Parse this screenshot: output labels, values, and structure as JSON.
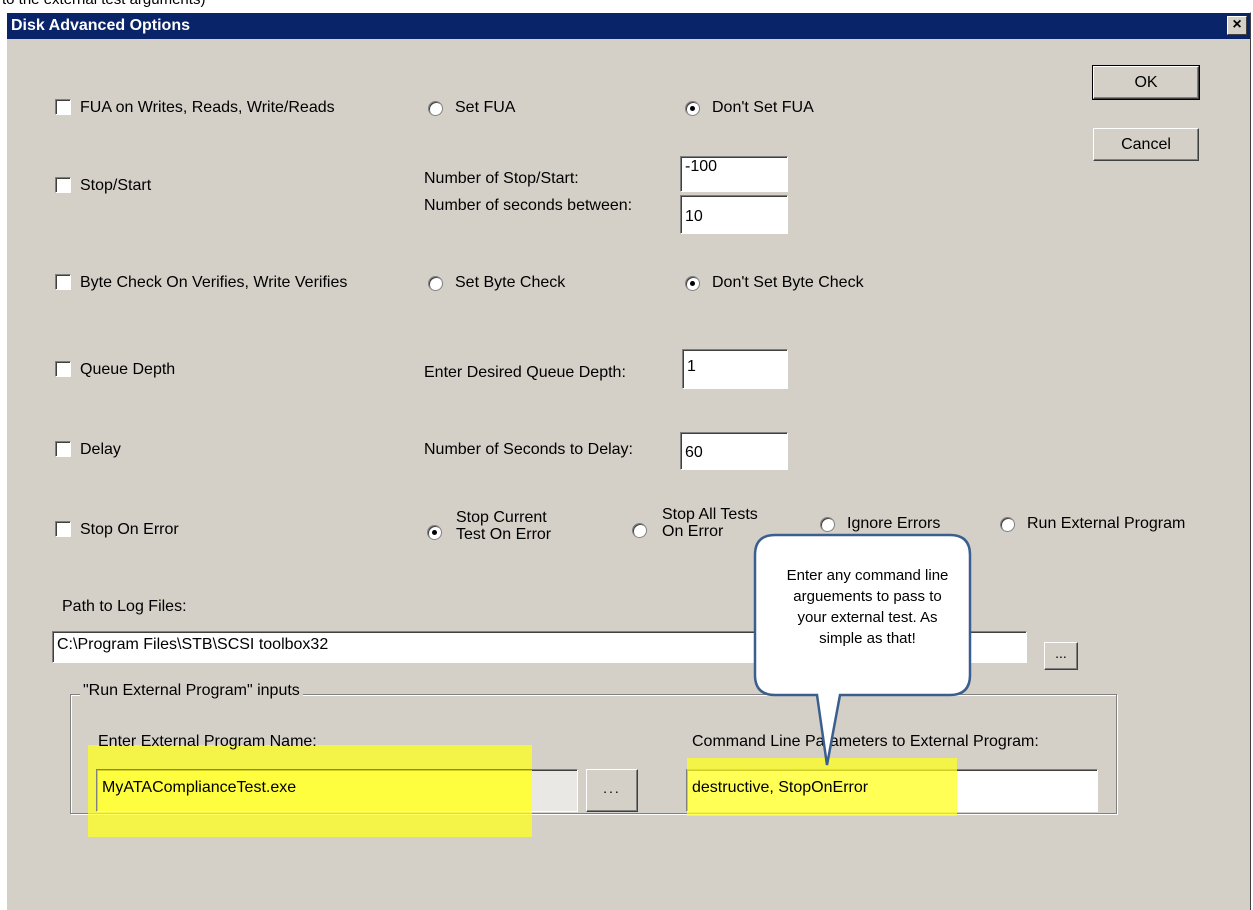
{
  "top_caption": "to the external test arguments)",
  "dialog": {
    "title": "Disk Advanced Options",
    "close_glyph": "×"
  },
  "buttons": {
    "ok": "OK",
    "cancel": "Cancel",
    "browse": "...",
    "browse_exe": "..."
  },
  "rows": {
    "fua": {
      "checkbox": "FUA on Writes, Reads, Write/Reads",
      "opt1": "Set FUA",
      "opt2": "Don't Set FUA",
      "selected": "opt2"
    },
    "stopstart": {
      "checkbox": "Stop/Start",
      "count_label": "Number of Stop/Start:",
      "count_value": "-100",
      "seconds_label": "Number of seconds between:",
      "seconds_value": "10"
    },
    "bytecheck": {
      "checkbox": "Byte Check On Verifies, Write Verifies",
      "opt1": "Set  Byte Check",
      "opt2": "Don't Set Byte Check",
      "selected": "opt2"
    },
    "queue": {
      "checkbox": "Queue Depth",
      "label": "Enter Desired Queue Depth:",
      "value": "1"
    },
    "delay": {
      "checkbox": "Delay",
      "label": "Number of Seconds to Delay:",
      "value": "60"
    },
    "stoponerror": {
      "checkbox": "Stop On Error",
      "opt1_line1": "Stop Current",
      "opt1_line2": "Test On Error",
      "opt2_line1": "Stop All Tests",
      "opt2_line2": "On Error",
      "opt3": "Ignore Errors",
      "opt4": "Run External Program",
      "selected": "opt1"
    }
  },
  "log": {
    "label": "Path to Log Files:",
    "value": "C:\\Program Files\\STB\\SCSI toolbox32"
  },
  "external": {
    "group_label": "\"Run External Program\" inputs",
    "program_label": "Enter External Program Name:",
    "program_value": "MyATAComplianceTest.exe",
    "params_label": "Command Line Parameters to External Program:",
    "params_value": "destructive, StopOnError"
  },
  "callout": {
    "lines": [
      "Enter any command line",
      "arguements to pass to",
      "your external test. As",
      "simple as that!"
    ]
  },
  "colors": {
    "titlebar": "#0a246a",
    "face": "#d4d0c8",
    "highlight": "#ffff1e",
    "callout_border": "#3a5f8f"
  }
}
